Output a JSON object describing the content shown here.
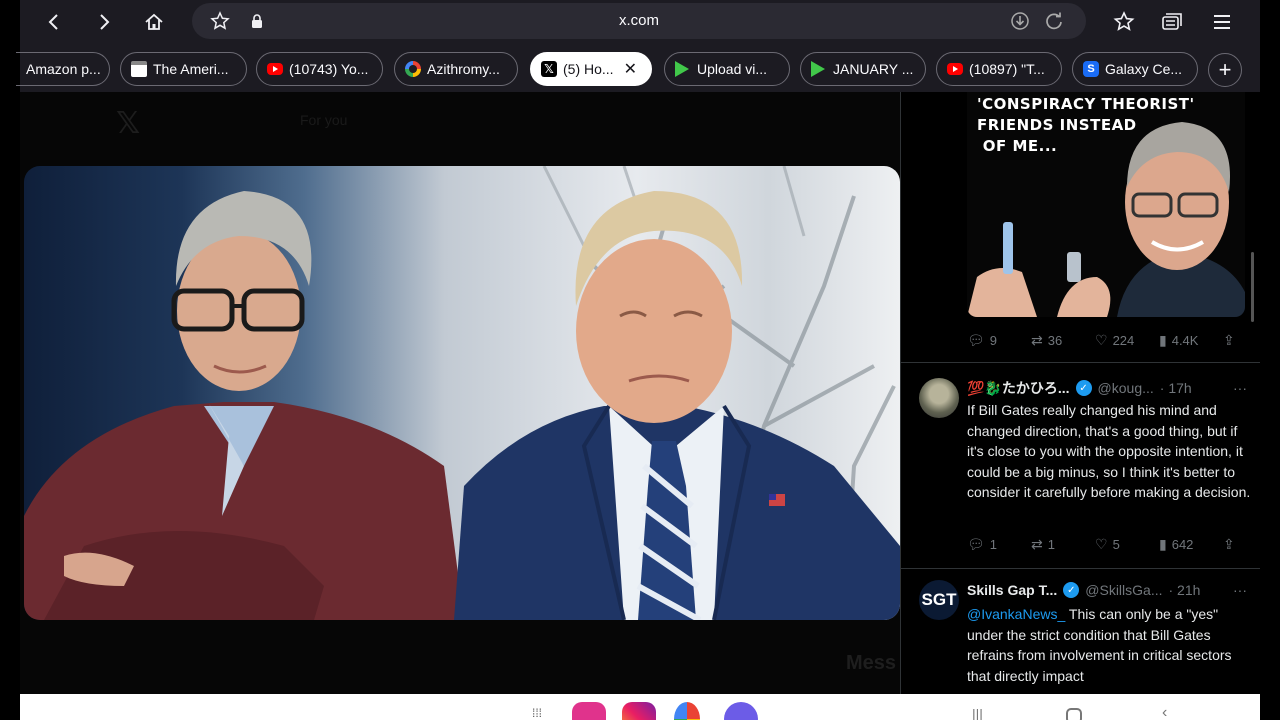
{
  "browser": {
    "url": "x.com",
    "tabs": [
      {
        "label": "Amazon p...",
        "favicon": "amazon"
      },
      {
        "label": "The Ameri...",
        "favicon": "page"
      },
      {
        "label": "(10743) Yo...",
        "favicon": "youtube"
      },
      {
        "label": "Azithromy...",
        "favicon": "google"
      },
      {
        "label": "(5) Ho...",
        "favicon": "x",
        "active": true
      },
      {
        "label": "Upload vi...",
        "favicon": "play"
      },
      {
        "label": "JANUARY ...",
        "favicon": "play"
      },
      {
        "label": "(10897) \"T...",
        "favicon": "youtube"
      },
      {
        "label": "Galaxy Ce...",
        "favicon": "samsung"
      }
    ],
    "x_logo": "𝕏"
  },
  "background": {
    "logo": "𝕏",
    "tab_label": "For you",
    "messages_label": "Mess"
  },
  "meme": {
    "text": "'CONSPIRACY THEORIST'\nFRIENDS INSTEAD\n OF ME..."
  },
  "first_tweet_actions": {
    "replies": "9",
    "reposts": "36",
    "likes": "224",
    "views": "4.4K"
  },
  "tweets": [
    {
      "name": "💯🐉たかひろ...",
      "handle": "@koug...",
      "time": "· 17h",
      "body": "If Bill Gates really changed his mind and changed direction, that's a good thing, but if it's close to you with the opposite intention, it could be a big minus, so I think it's better to consider it carefully before making a decision.",
      "replies": "1",
      "reposts": "1",
      "likes": "5",
      "views": "642"
    },
    {
      "name": "Skills Gap T...",
      "handle": "@SkillsGa...",
      "time": "· 21h",
      "avatar_text": "SGT",
      "mention": "@IvankaNews_",
      "body": " This can only be a \"yes\" under the strict condition that Bill Gates refrains from involvement in critical sectors that directly impact"
    }
  ],
  "colors": {
    "accent": "#1d9bf0",
    "muted": "#71767b",
    "chrome": "#1c1b22"
  }
}
